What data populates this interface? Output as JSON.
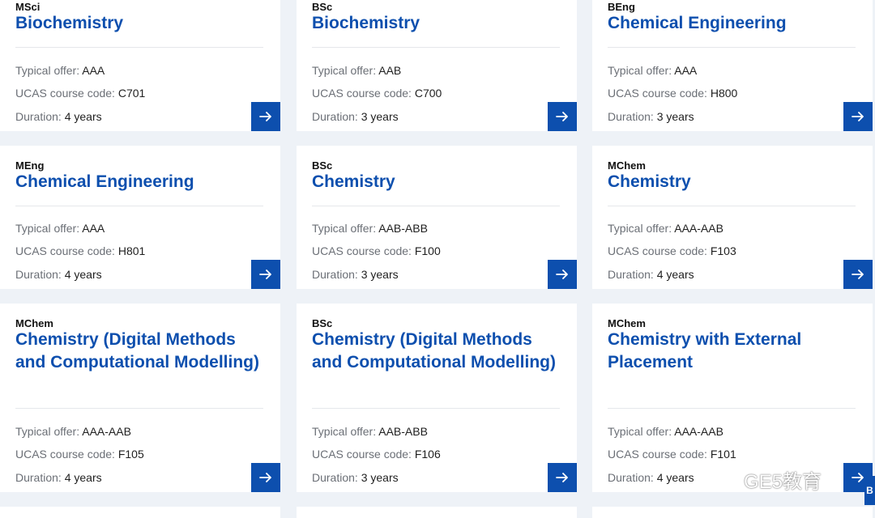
{
  "labels": {
    "typical_offer": "Typical offer:",
    "ucas_code": "UCAS course code:",
    "duration": "Duration:"
  },
  "courses": [
    {
      "degree": "MSci",
      "title": "Biochemistry",
      "offer": "AAA",
      "ucas": "C701",
      "duration": "4 years"
    },
    {
      "degree": "BSc",
      "title": "Biochemistry",
      "offer": "AAB",
      "ucas": "C700",
      "duration": "3 years"
    },
    {
      "degree": "BEng",
      "title": "Chemical Engineering",
      "offer": "AAA",
      "ucas": "H800",
      "duration": "3 years"
    },
    {
      "degree": "MEng",
      "title": "Chemical Engineering",
      "offer": "AAA",
      "ucas": "H801",
      "duration": "4 years"
    },
    {
      "degree": "BSc",
      "title": "Chemistry",
      "offer": "AAB-ABB",
      "ucas": "F100",
      "duration": "3 years"
    },
    {
      "degree": "MChem",
      "title": "Chemistry",
      "offer": "AAA-AAB",
      "ucas": "F103",
      "duration": "4 years"
    },
    {
      "degree": "MChem",
      "title": "Chemistry (Digital Methods and Computational Modelling)",
      "offer": "AAA-AAB",
      "ucas": "F105",
      "duration": "4 years"
    },
    {
      "degree": "BSc",
      "title": "Chemistry (Digital Methods and Computational Modelling)",
      "offer": "AAB-ABB",
      "ucas": "F106",
      "duration": "3 years"
    },
    {
      "degree": "MChem",
      "title": "Chemistry with External Placement",
      "offer": "AAA-AAB",
      "ucas": "F101",
      "duration": "4 years"
    }
  ],
  "watermark": {
    "text": "GE5教育",
    "icon": "wechat-icon"
  },
  "edge_tab": {
    "label": "B"
  },
  "colors": {
    "accent": "#0d4fae",
    "background": "#eef2f7",
    "card": "#ffffff"
  }
}
